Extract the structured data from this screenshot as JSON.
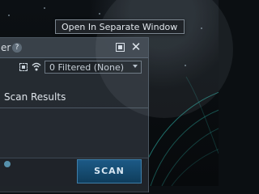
{
  "tooltip": {
    "text": "Open In Separate Window"
  },
  "panel": {
    "title": "er",
    "help": "?",
    "close": "✕",
    "filter": {
      "selected": "0 Filtered (None)"
    },
    "section_title": "Scan Results",
    "scan_button": "SCAN"
  },
  "icons": {
    "help": "help-icon",
    "popout": "popout-window-icon",
    "close": "close-icon",
    "target": "target-icon",
    "signal": "signal-icon",
    "chevron": "chevron-down-icon"
  },
  "colors": {
    "scan_button": "#1c5a86",
    "panel_bg": "#282e34",
    "orbit_lines": "#2aa39a"
  }
}
